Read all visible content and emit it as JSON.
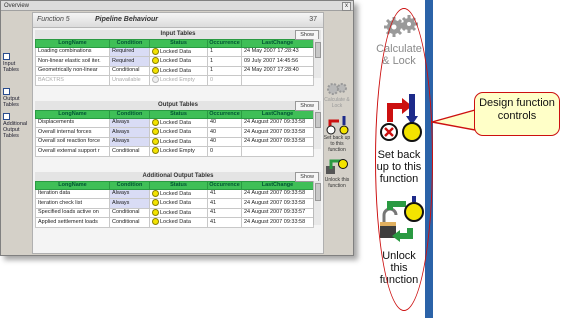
{
  "window": {
    "title": "Overview",
    "close_glyph": "x"
  },
  "header": {
    "function_no": "Function 5",
    "name": "Pipeline Behaviour",
    "count": "37"
  },
  "sidebar": [
    {
      "label": "Input Tables"
    },
    {
      "label": "Output Tables"
    },
    {
      "label": "Additional Output Tables"
    }
  ],
  "columns": [
    "LongName",
    "Condition",
    "Status",
    "Occurrence",
    "LastChange"
  ],
  "show_label": "Show",
  "input_tables": {
    "title": "Input Tables",
    "rows": [
      {
        "name": "Loading combinations",
        "condition": "Required",
        "status": "Locked Data",
        "occurrence": "1",
        "last_change": "24 May 2007 17:28:43",
        "dim": false
      },
      {
        "name": "Non-linear elastic soil iter.",
        "condition": "Required",
        "status": "Locked Data",
        "occurrence": "1",
        "last_change": "09 July 2007 14:45:56",
        "dim": false
      },
      {
        "name": "Geometrically non-linear",
        "condition": "Conditional",
        "status": "Locked Data",
        "occurrence": "1",
        "last_change": "24 May 2007 17:28:40",
        "dim": false
      },
      {
        "name": "BACKTRS",
        "condition": "Unavailable",
        "status": "Locked Empty",
        "occurrence": "0",
        "last_change": "",
        "dim": true
      }
    ]
  },
  "output_tables": {
    "title": "Output Tables",
    "rows": [
      {
        "name": "Displacements",
        "condition": "Always",
        "status": "Locked Data",
        "occurrence": "40",
        "last_change": "24 August 2007 09:33:58"
      },
      {
        "name": "Overall internal forces",
        "condition": "Always",
        "status": "Locked Data",
        "occurrence": "40",
        "last_change": "24 August 2007 09:33:58"
      },
      {
        "name": "Overall soil reaction force",
        "condition": "Always",
        "status": "Locked Data",
        "occurrence": "40",
        "last_change": "24 August 2007 09:33:58"
      },
      {
        "name": "Overall external support r",
        "condition": "Conditional",
        "status": "Locked Empty",
        "occurrence": "0",
        "last_change": ""
      }
    ]
  },
  "additional_tables": {
    "title": "Additional Output Tables",
    "rows": [
      {
        "name": "Iteration data",
        "condition": "Always",
        "status": "Locked Data",
        "occurrence": "41",
        "last_change": "24 August 2007 09:33:58"
      },
      {
        "name": "Iteration check list",
        "condition": "Always",
        "status": "Locked Data",
        "occurrence": "41",
        "last_change": "24 August 2007 09:33:58"
      },
      {
        "name": "Specified loads active on",
        "condition": "Conditional",
        "status": "Locked Data",
        "occurrence": "41",
        "last_change": "24 August 2007 09:33:57"
      },
      {
        "name": "Applied settlement loads",
        "condition": "Conditional",
        "status": "Locked Data",
        "occurrence": "41",
        "last_change": "24 August 2007 09:33:58"
      }
    ]
  },
  "mini_controls": {
    "calc": "Calculate & Lock",
    "setback": "Set back up to this function",
    "unlock": "Unlock this function"
  },
  "panel": {
    "calc_label": "Calculate & Lock",
    "setback_label": "Set back up to this function",
    "unlock_label": "Unlock this function"
  },
  "callout": {
    "text": "Design function controls"
  },
  "colors": {
    "header_green": "#3fbf57",
    "status_yellow": "#f3e300",
    "accent_red": "#cc1010",
    "strip_blue": "#2b63a8"
  }
}
